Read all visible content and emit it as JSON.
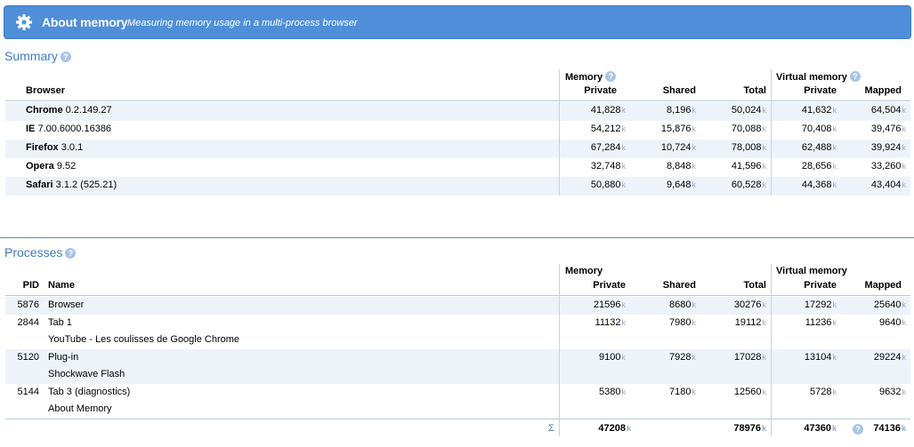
{
  "header": {
    "title": "About memory",
    "subtitle": "Measuring memory usage in a multi-process browser",
    "icon": "gear-icon"
  },
  "summary": {
    "title": "Summary",
    "col_browser": "Browser",
    "group_memory": "Memory",
    "group_virtual": "Virtual memory",
    "col_private": "Private",
    "col_shared": "Shared",
    "col_total": "Total",
    "col_vprivate": "Private",
    "col_mapped": "Mapped",
    "unit": "k",
    "rows": [
      {
        "name": "Chrome",
        "version": "0.2.149.27",
        "private": "41,828",
        "shared": "8,196",
        "total": "50,024",
        "vprivate": "41,632",
        "mapped": "64,504"
      },
      {
        "name": "IE",
        "version": "7.00.6000.16386",
        "private": "54,212",
        "shared": "15,876",
        "total": "70,088",
        "vprivate": "70,408",
        "mapped": "39,476"
      },
      {
        "name": "Firefox",
        "version": "3.0.1",
        "private": "67,284",
        "shared": "10,724",
        "total": "78,008",
        "vprivate": "62,488",
        "mapped": "39,924"
      },
      {
        "name": "Opera",
        "version": "9.52",
        "private": "32,748",
        "shared": "8,848",
        "total": "41,596",
        "vprivate": "28,656",
        "mapped": "33,260"
      },
      {
        "name": "Safari",
        "version": "3.1.2 (525.21)",
        "private": "50,880",
        "shared": "9,648",
        "total": "60,528",
        "vprivate": "44,368",
        "mapped": "43,404"
      }
    ]
  },
  "processes": {
    "title": "Processes",
    "col_pid": "PID",
    "col_name": "Name",
    "group_memory": "Memory",
    "group_virtual": "Virtual memory",
    "col_private": "Private",
    "col_shared": "Shared",
    "col_total": "Total",
    "col_vprivate": "Private",
    "col_mapped": "Mapped",
    "unit": "k",
    "rows": [
      {
        "pid": "5876",
        "name": "Browser",
        "detail": "",
        "private": "21596",
        "shared": "8680",
        "total": "30276",
        "vprivate": "17292",
        "mapped": "25640"
      },
      {
        "pid": "2844",
        "name": "Tab 1",
        "detail": "YouTube - Les coulisses de Google Chrome",
        "private": "11132",
        "shared": "7980",
        "total": "19112",
        "vprivate": "11236",
        "mapped": "9640"
      },
      {
        "pid": "5120",
        "name": "Plug-in",
        "detail": "Shockwave Flash",
        "private": "9100",
        "shared": "7928",
        "total": "17028",
        "vprivate": "13104",
        "mapped": "29224"
      },
      {
        "pid": "5144",
        "name": "Tab 3 (diagnostics)",
        "detail": "About Memory",
        "private": "5380",
        "shared": "7180",
        "total": "12560",
        "vprivate": "5728",
        "mapped": "9632"
      }
    ],
    "totals": {
      "sigma": "Σ",
      "private": "47208",
      "total": "78976",
      "vprivate": "47360",
      "mapped": "74136"
    }
  },
  "colors": {
    "header_bg": "#4f8fd9",
    "section_title": "#3e7cc4",
    "row_shade": "#eef3fa"
  }
}
